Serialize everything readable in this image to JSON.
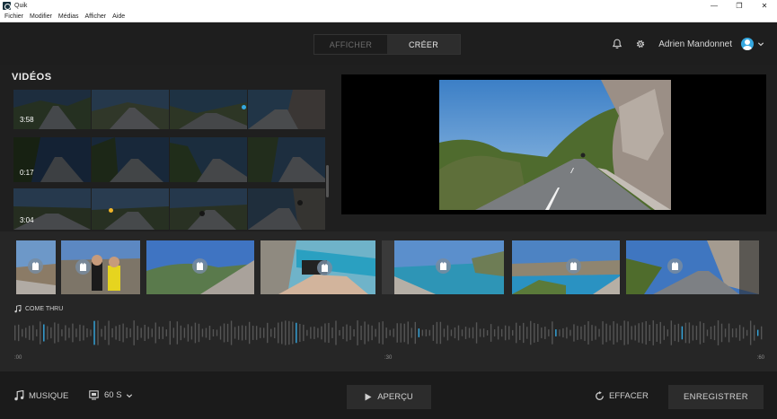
{
  "window": {
    "title": "Quik",
    "controls": [
      "—",
      "❐",
      "✕"
    ]
  },
  "menu": [
    "Fichier",
    "Modifier",
    "Médias",
    "Afficher",
    "Aide"
  ],
  "header": {
    "tabs": [
      {
        "label": "AFFICHER",
        "active": false
      },
      {
        "label": "CRÉER",
        "active": true
      }
    ],
    "user_name": "Adrien Mandonnet"
  },
  "library": {
    "title": "VIDÉOS",
    "rows": [
      {
        "duration": "3:58"
      },
      {
        "duration": "0:17"
      },
      {
        "duration": "3:04"
      }
    ]
  },
  "timeline": {
    "track_name": "COME THRU",
    "ticks": [
      ":00",
      ":30",
      ":60"
    ]
  },
  "bottom": {
    "music_label": "MUSIQUE",
    "duration_label": "60 S",
    "preview_label": "APERÇU",
    "clear_label": "EFFACER",
    "save_label": "ENREGISTRER"
  },
  "colors": {
    "accent": "#35a8e0",
    "background": "#1f1f1f"
  }
}
